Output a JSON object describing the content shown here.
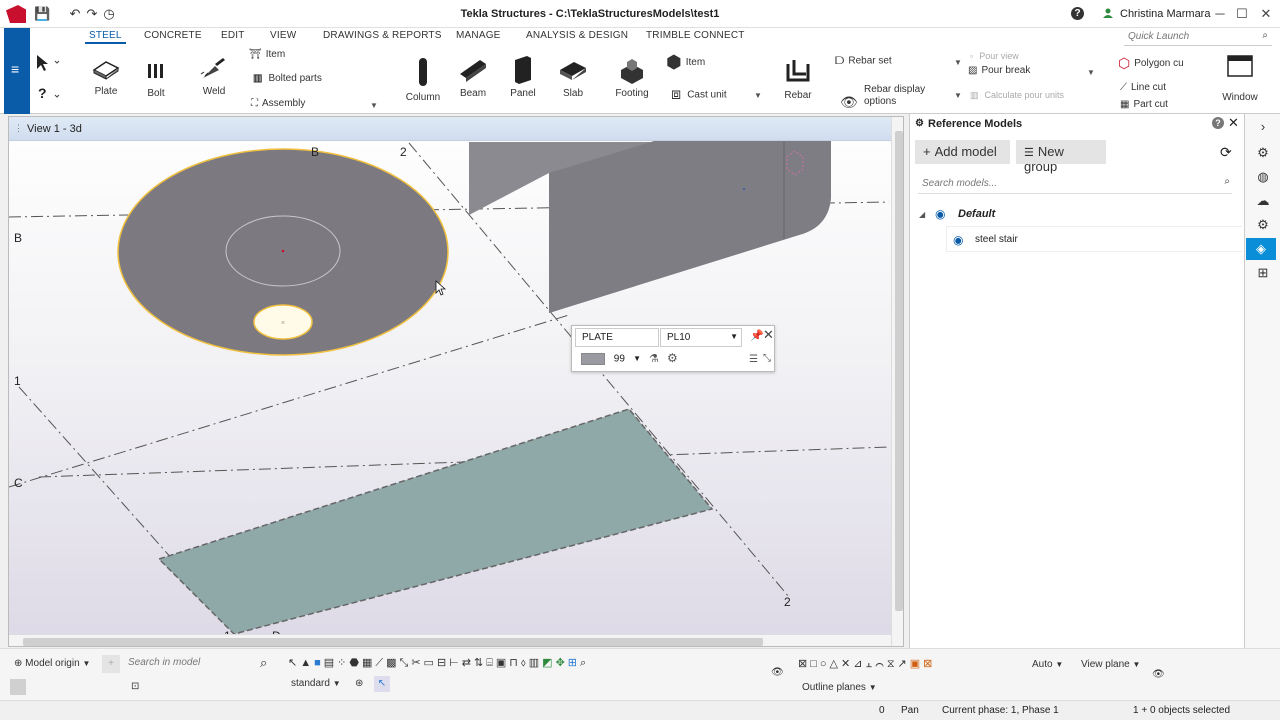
{
  "window": {
    "title": "Tekla Structures - C:\\TeklaStructuresModels\\test1",
    "user": "Christina Marmara"
  },
  "ribbon": {
    "tabs": [
      "STEEL",
      "CONCRETE",
      "EDIT",
      "VIEW",
      "DRAWINGS & REPORTS",
      "MANAGE",
      "ANALYSIS & DESIGN",
      "TRIMBLE CONNECT"
    ],
    "active_tab": "STEEL",
    "quick_launch_placeholder": "Quick Launch",
    "steel": {
      "plate": "Plate",
      "bolt": "Bolt",
      "weld": "Weld",
      "item": "Item",
      "bolted_parts": "Bolted parts",
      "assembly": "Assembly"
    },
    "concrete": {
      "column": "Column",
      "beam": "Beam",
      "panel": "Panel",
      "slab": "Slab",
      "footing": "Footing",
      "item": "Item",
      "cast_unit": "Cast unit",
      "rebar": "Rebar",
      "rebar_set": "Rebar set",
      "rebar_display_options": "Rebar display options",
      "pour_view": "Pour view",
      "pour_break": "Pour break",
      "calculate_pour_units": "Calculate pour units",
      "polygon_cut": "Polygon cu",
      "line_cut": "Line cut",
      "part_cut": "Part cut"
    },
    "window": "Window"
  },
  "viewport": {
    "title": "View 1 - 3d",
    "grid_labels": {
      "b_top": "B",
      "two_top": "2",
      "b_left": "B",
      "one_left": "1",
      "c_left": "C",
      "two_bottom": "2",
      "one_bottom": "1",
      "d_bottom": "D"
    },
    "context_toolbar": {
      "type": "PLATE",
      "profile": "PL10",
      "class": "99"
    },
    "colors": {
      "disc": "#7c7a80",
      "selection": "#f0c040",
      "plate": "#8fa8a8"
    }
  },
  "reference_models": {
    "title": "Reference Models",
    "add_model": "Add model",
    "new_group": "New group",
    "search_placeholder": "Search models...",
    "group": "Default",
    "items": [
      "steel stair"
    ]
  },
  "bottom": {
    "model_origin": "Model origin",
    "search_placeholder": "Search in model",
    "standard": "standard",
    "auto": "Auto",
    "view_plane": "View plane",
    "outline_planes": "Outline planes"
  },
  "status": {
    "number": "0",
    "mode": "Pan",
    "phase": "Current phase: 1, Phase 1",
    "selection": "1 + 0 objects selected"
  }
}
